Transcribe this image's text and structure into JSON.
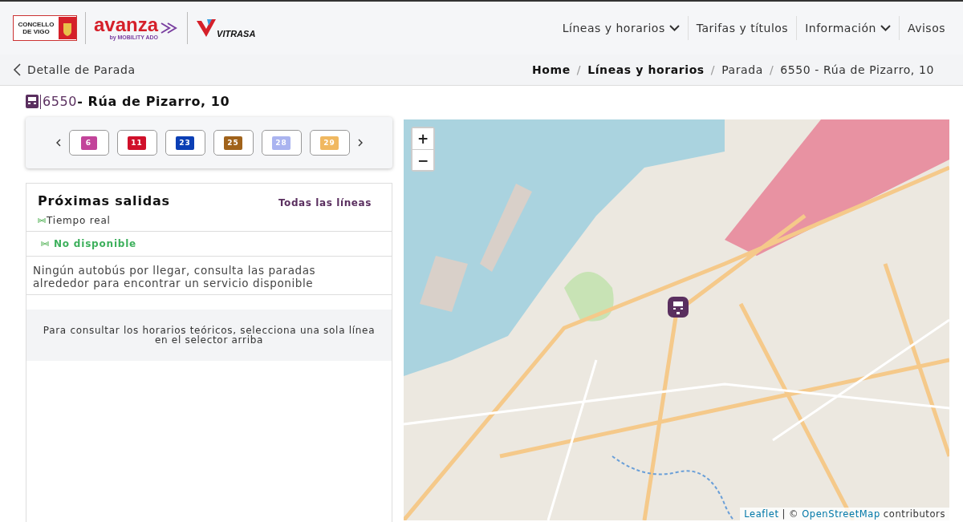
{
  "header": {
    "logos": {
      "concello": "CONCELLO DE VIGO",
      "avanza": "avanza",
      "avanza_sub": "by MOBILITY ADO",
      "vitrasa": "VITRASA"
    },
    "nav": [
      {
        "label": "Líneas y horarios",
        "dropdown": true
      },
      {
        "label": "Tarifas y títulos",
        "dropdown": false
      },
      {
        "label": "Información",
        "dropdown": true
      },
      {
        "label": "Avisos",
        "dropdown": false
      }
    ]
  },
  "subheader": {
    "back_label": "Detalle de Parada",
    "separator": "/",
    "breadcrumb": [
      {
        "label": "Home",
        "bold": true
      },
      {
        "label": "Líneas y horarios",
        "bold": true
      },
      {
        "label": "Parada",
        "bold": false
      },
      {
        "label": "6550 - Rúa de Pizarro, 10",
        "bold": false
      }
    ]
  },
  "stop": {
    "code": "6550",
    "name": "- Rúa de Pizarro, 10"
  },
  "lines": [
    {
      "label": "6",
      "color": "#c2449a",
      "selected": false
    },
    {
      "label": "11",
      "color": "#d0102a",
      "selected": false
    },
    {
      "label": "23",
      "color": "#0b3fb5",
      "selected": false
    },
    {
      "label": "25",
      "color": "#a0621a",
      "selected": false
    },
    {
      "label": "28",
      "color": "#aab4f0",
      "selected": false
    },
    {
      "label": "29",
      "color": "#f0b860",
      "selected": false
    }
  ],
  "departures": {
    "title": "Próximas salidas",
    "all_lines_link": "Todas las líneas",
    "realtime_label": "Tiempo real",
    "status": "No disponible",
    "message": "Ningún autobús por llegar, consulta las paradas alrededor para encontrar un servicio disponible",
    "schedule_hint": "Para consultar los horarios teóricos, selecciona una sola línea en el selector arriba"
  },
  "map": {
    "zoom_in": "+",
    "zoom_out": "−",
    "attribution_link": "Leaflet",
    "attribution_sep": "|",
    "attribution_osm_prefix": "©",
    "attribution_osm_link": "OpenStreetMap",
    "attribution_suffix": "contributors"
  }
}
